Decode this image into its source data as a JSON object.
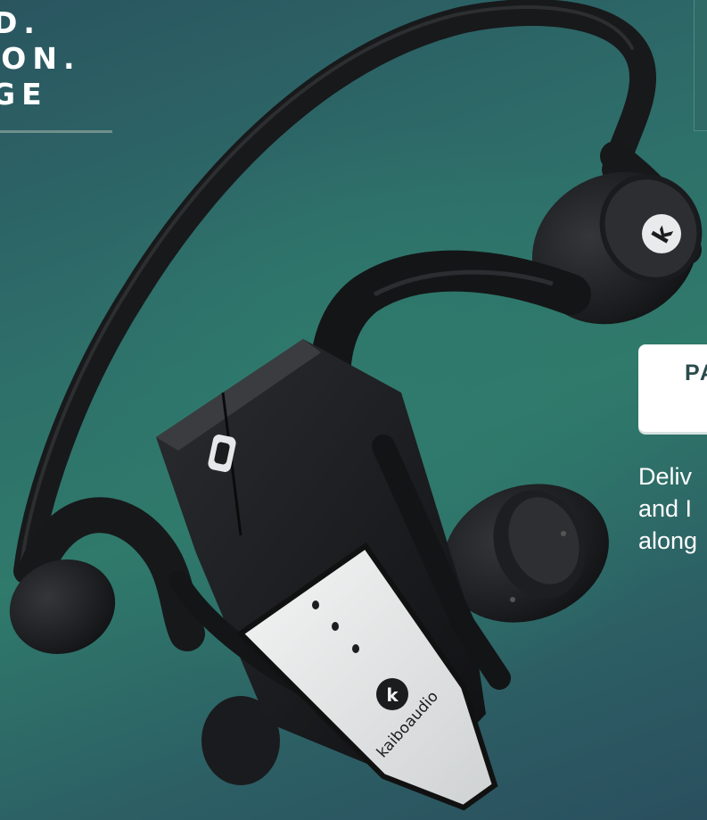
{
  "headline": {
    "line1": "D.",
    "line2": "ION.",
    "line3": "GE"
  },
  "tab_card": {
    "label": "PA"
  },
  "description": {
    "line1": "Deliv",
    "line2": "and I",
    "line3": "along"
  },
  "product": {
    "brand_logo_text": "kaiboaudio",
    "icon_names": [
      "kaibo-logo-icon",
      "usb-port-icon",
      "indicator-led-icon"
    ]
  },
  "colors": {
    "background_teal": "#2f7a6b",
    "device_black": "#1b1c1e",
    "panel_white": "#ecedee"
  }
}
